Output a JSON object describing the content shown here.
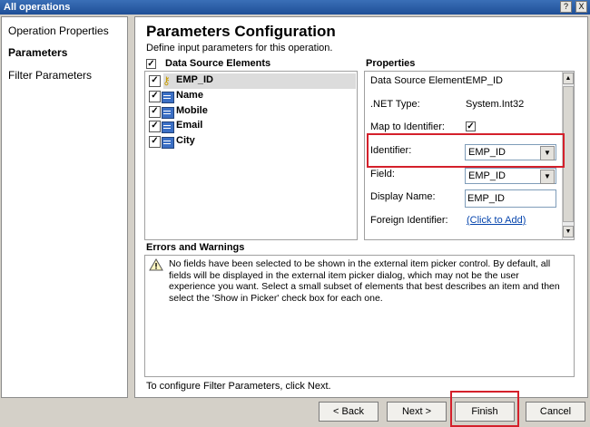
{
  "window": {
    "title": "All operations",
    "controls": {
      "help": "?",
      "close": "X"
    }
  },
  "nav": {
    "items": [
      {
        "label": "Operation Properties"
      },
      {
        "label": "Parameters"
      },
      {
        "label": "Filter Parameters"
      }
    ]
  },
  "main": {
    "heading": "Parameters Configuration",
    "subheading": "Define input parameters for this operation.",
    "data_source": {
      "label": "Data Source Elements",
      "items": [
        {
          "label": "EMP_ID",
          "checked": true
        },
        {
          "label": "Name",
          "checked": true
        },
        {
          "label": "Mobile",
          "checked": true
        },
        {
          "label": "Email",
          "checked": true
        },
        {
          "label": "City",
          "checked": true
        }
      ]
    },
    "properties": {
      "label": "Properties",
      "data_source_element": {
        "label": "Data Source Element:",
        "value": "EMP_ID"
      },
      "net_type": {
        "label": ".NET Type:",
        "value": "System.Int32"
      },
      "map_to_identifier": {
        "label": "Map to Identifier:",
        "checked": true
      },
      "identifier": {
        "label": "Identifier:",
        "value": "EMP_ID"
      },
      "field": {
        "label": "Field:",
        "value": "EMP_ID"
      },
      "display_name": {
        "label": "Display Name:",
        "value": "EMP_ID"
      },
      "foreign_identifier": {
        "label": "Foreign Identifier:",
        "value": "(Click to Add)"
      }
    },
    "errors": {
      "label": "Errors and Warnings",
      "message": "No fields have been selected to be shown in the external item picker control. By default, all fields will be displayed in the external item picker dialog, which may not be the user experience you want. Select a small subset of elements that best describes an item and then select the 'Show in Picker' check box for each one."
    },
    "status": "To configure Filter Parameters, click Next."
  },
  "buttons": {
    "back": "< Back",
    "next": "Next >",
    "finish": "Finish",
    "cancel": "Cancel"
  },
  "colors": {
    "highlight": "#d4202b",
    "titlebar": "#2a5ea8",
    "link": "#0645ad"
  }
}
